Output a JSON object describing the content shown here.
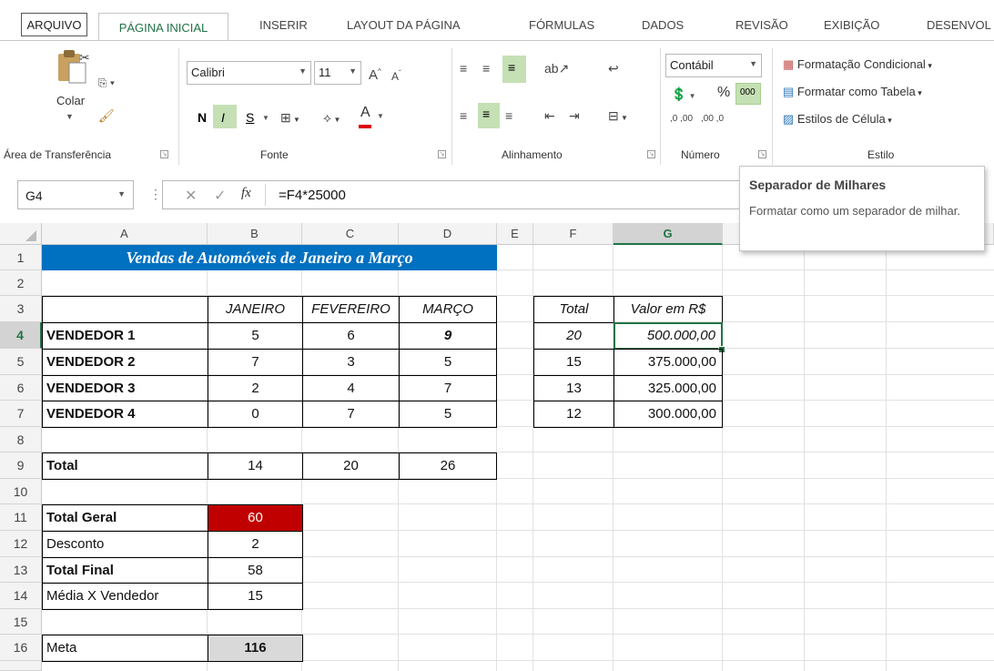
{
  "ribbon_tabs": {
    "file": "ARQUIVO",
    "home": "PÁGINA INICIAL",
    "insert": "INSERIR",
    "layout": "LAYOUT DA PÁGINA",
    "formulas": "FÓRMULAS",
    "data": "DADOS",
    "review": "REVISÃO",
    "view": "EXIBIÇÃO",
    "developer": "DESENVOL"
  },
  "clipboard": {
    "paste_label": "Colar",
    "group_label": "Área de Transferência"
  },
  "font": {
    "name": "Calibri",
    "size": "11",
    "bold": "N",
    "italic": "I",
    "underline": "S",
    "group_label": "Fonte"
  },
  "alignment": {
    "group_label": "Alinhamento"
  },
  "number": {
    "format": "Contábil",
    "percent": "%",
    "thousands": "000",
    "inc_decimals": ",0 ,00",
    "dec_decimals": ",00 ,0",
    "group_label": "Número"
  },
  "styles": {
    "conditional": "Formatação Condicional",
    "as_table": "Formatar como Tabela",
    "cell_styles": "Estilos de Célula",
    "group_label": "Estilo"
  },
  "tooltip": {
    "title": "Separador de Milhares",
    "body": "Formatar como um separador de milhar."
  },
  "formula_bar": {
    "name_box": "G4",
    "fx": "fx",
    "formula": "=F4*25000"
  },
  "columns": [
    "A",
    "B",
    "C",
    "D",
    "E",
    "F",
    "G"
  ],
  "rows": [
    "1",
    "2",
    "3",
    "4",
    "5",
    "6",
    "7",
    "8",
    "9",
    "10",
    "11",
    "12",
    "13",
    "14",
    "15",
    "16"
  ],
  "sheet": {
    "title": "Vendas de Automóveis de Janeiro a Março",
    "months": [
      "JANEIRO",
      "FEVEREIRO",
      "MARÇO"
    ],
    "sellers": [
      {
        "name": "VENDEDOR 1",
        "jan": "5",
        "fev": "6",
        "mar": "9"
      },
      {
        "name": "VENDEDOR 2",
        "jan": "7",
        "fev": "3",
        "mar": "5"
      },
      {
        "name": "VENDEDOR 3",
        "jan": "2",
        "fev": "4",
        "mar": "7"
      },
      {
        "name": "VENDEDOR 4",
        "jan": "0",
        "fev": "7",
        "mar": "5"
      }
    ],
    "total_label": "Total",
    "totals": [
      "14",
      "20",
      "26"
    ],
    "side_headers": [
      "Total",
      "Valor em R$"
    ],
    "side_rows": [
      {
        "total": "20",
        "value": "500.000,00"
      },
      {
        "total": "15",
        "value": "375.000,00"
      },
      {
        "total": "13",
        "value": "325.000,00"
      },
      {
        "total": "12",
        "value": "300.000,00"
      }
    ],
    "summary": [
      {
        "label": "Total Geral",
        "value": "60"
      },
      {
        "label": "Desconto",
        "value": "2"
      },
      {
        "label": "Total Final",
        "value": "58"
      },
      {
        "label": "Média X Vendedor",
        "value": "15"
      }
    ],
    "meta_label": "Meta",
    "meta_value": "116"
  },
  "colors": {
    "title_bg": "#0070c0",
    "total_geral_bg": "#c00000",
    "meta_bg": "#d9d9d9",
    "selection": "#217346"
  }
}
